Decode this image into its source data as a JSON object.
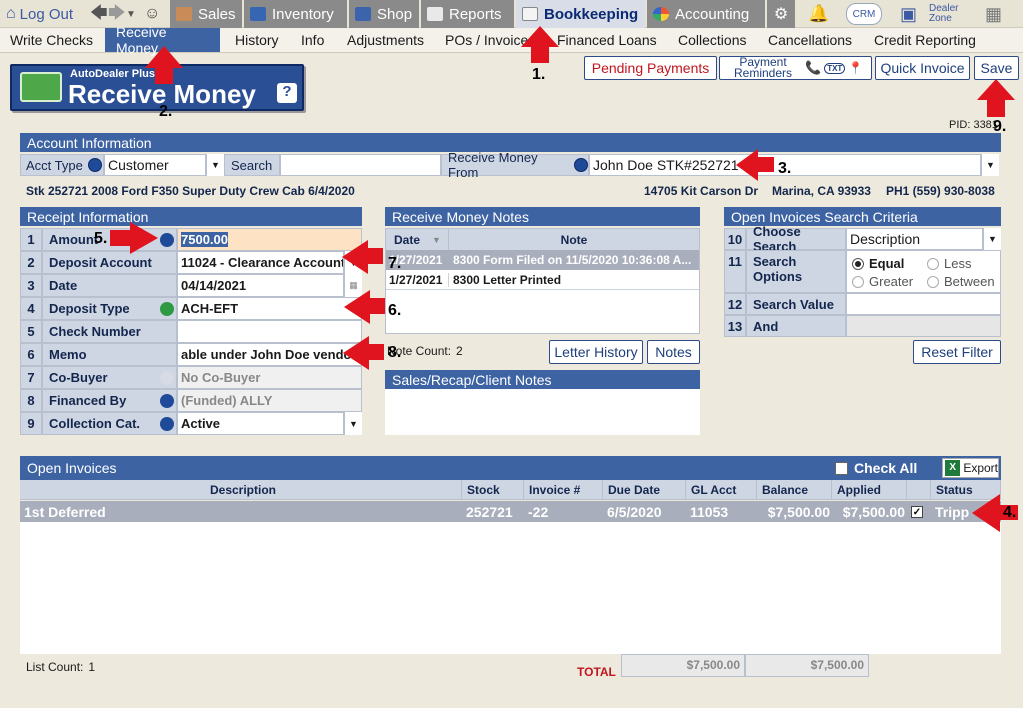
{
  "topbar": {
    "logout": "Log Out",
    "tabs": [
      "Sales",
      "Inventory",
      "Shop",
      "Reports",
      "Bookkeeping",
      "Accounting"
    ],
    "crm": "CRM",
    "dealer_zone": "Dealer Zone"
  },
  "subnav": [
    "Write Checks",
    "Receive Money",
    "History",
    "Info",
    "Adjustments",
    "POs / Invoices",
    "Financed Loans",
    "Collections",
    "Cancellations",
    "Credit Reporting"
  ],
  "logo": {
    "small": "AutoDealer Plus",
    "big": "Receive Money",
    "help": "?"
  },
  "actions": {
    "pending": "Pending Payments",
    "reminders": "Payment Reminders",
    "txt": "TXT",
    "quick_invoice": "Quick Invoice",
    "save": "Save"
  },
  "pid": "PID: 3381",
  "account": {
    "title": "Account Information",
    "acct_type_label": "Acct Type",
    "acct_type_value": "Customer",
    "search_label": "Search",
    "search_value": "",
    "receive_from_label": "Receive Money From",
    "receive_from_value": "John Doe  STK#252721",
    "vehicle": "Stk 252721 2008 Ford F350 Super Duty Crew Cab 6/4/2020",
    "address": "14705 Kit Carson Dr",
    "city": "Marina, CA 93933",
    "phone": "PH1 (559) 930-8038"
  },
  "receipt": {
    "title": "Receipt Information",
    "rows": [
      {
        "n": "1",
        "label": "Amount",
        "value": "7500.00"
      },
      {
        "n": "2",
        "label": "Deposit Account",
        "value": "11024 - Clearance Account"
      },
      {
        "n": "3",
        "label": "Date",
        "value": "04/14/2021"
      },
      {
        "n": "4",
        "label": "Deposit Type",
        "value": "ACH-EFT"
      },
      {
        "n": "5",
        "label": "Check Number",
        "value": ""
      },
      {
        "n": "6",
        "label": "Memo",
        "value": "able under John Doe vendor"
      },
      {
        "n": "7",
        "label": "Co-Buyer",
        "value": "No Co-Buyer"
      },
      {
        "n": "8",
        "label": "Financed By",
        "value": "(Funded) ALLY"
      },
      {
        "n": "9",
        "label": "Collection Cat.",
        "value": "Active"
      }
    ]
  },
  "notes": {
    "title": "Receive Money Notes",
    "col_date": "Date",
    "col_note": "Note",
    "rows": [
      {
        "date": "1/27/2021",
        "note": "8300 Form Filed on 11/5/2020 10:36:08 A..."
      },
      {
        "date": "1/27/2021",
        "note": "8300 Letter Printed"
      }
    ],
    "count_label": "Note Count:",
    "count": "2",
    "letter_history": "Letter History",
    "notes_btn": "Notes",
    "recap_title": "Sales/Recap/Client Notes"
  },
  "search_criteria": {
    "title": "Open Invoices Search Criteria",
    "choose_label": "Choose Search",
    "choose_value": "Description",
    "options_label": "Search Options",
    "opt_equal": "Equal",
    "opt_less": "Less",
    "opt_greater": "Greater",
    "opt_between": "Between",
    "value_label": "Search Value",
    "and_label": "And",
    "reset": "Reset Filter",
    "row_nums": [
      "10",
      "11",
      "12",
      "13"
    ]
  },
  "invoices": {
    "title": "Open Invoices",
    "check_all": "Check All",
    "export": "Export",
    "headers": [
      "Description",
      "Stock",
      "Invoice #",
      "Due Date",
      "GL Acct",
      "Balance",
      "Applied",
      "",
      "Status"
    ],
    "row": {
      "description": "1st Deferred",
      "stock": "252721",
      "invoice": "-22",
      "due": "6/5/2020",
      "gl": "11053",
      "balance": "$7,500.00",
      "applied": "$7,500.00",
      "status": "Tripp"
    },
    "list_count_label": "List Count:",
    "list_count": "1",
    "total_label": "TOTAL",
    "total_balance": "$7,500.00",
    "total_applied": "$7,500.00"
  },
  "annotations": [
    "1.",
    "2.",
    "3.",
    "4.",
    "5.",
    "6.",
    "7.",
    "8.",
    "9."
  ],
  "colors": {
    "accent": "#3d63a3",
    "arrow": "#e0141e",
    "background": "#ede9dc"
  }
}
